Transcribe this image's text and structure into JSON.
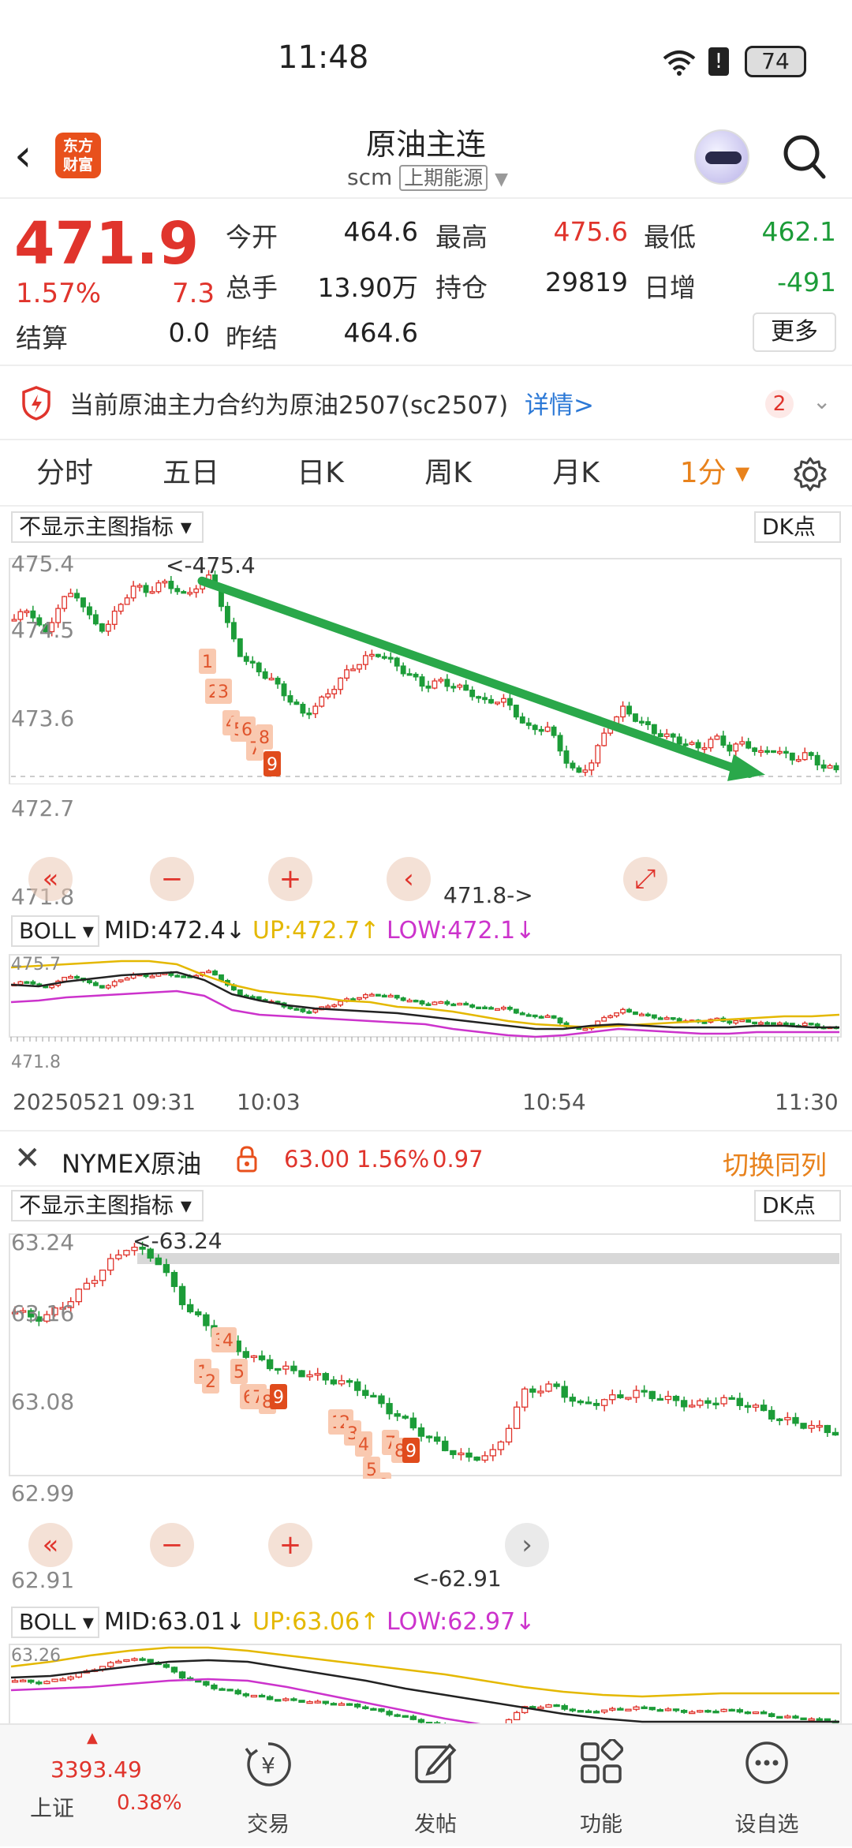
{
  "status": {
    "time": "11:48",
    "battery": "74"
  },
  "header": {
    "title": "原油主连",
    "code": "scm",
    "exchange": "上期能源",
    "logo_text_1": "东方",
    "logo_text_2": "财富"
  },
  "quote": {
    "price": "471.9",
    "change_pct": "1.57%",
    "change": "7.3",
    "fields": [
      {
        "label": "今开",
        "value": "464.6",
        "color": "#222"
      },
      {
        "label": "最高",
        "value": "475.6",
        "color": "#e0342c"
      },
      {
        "label": "最低",
        "value": "462.1",
        "color": "#1c9c38"
      },
      {
        "label": "总手",
        "value": "13.90万",
        "color": "#222"
      },
      {
        "label": "持仓",
        "value": "29819",
        "color": "#222"
      },
      {
        "label": "日增",
        "value": "-491",
        "color": "#1c9c38"
      },
      {
        "label": "结算",
        "value": "0.0",
        "color": "#222"
      },
      {
        "label": "昨结",
        "value": "464.6",
        "color": "#222"
      }
    ],
    "more_label": "更多"
  },
  "notice": {
    "text": "当前原油主力合约为原油2507(sc2507)",
    "link": "详情>",
    "count": "2"
  },
  "tabs": [
    {
      "label": "分时"
    },
    {
      "label": "五日"
    },
    {
      "label": "日K"
    },
    {
      "label": "周K"
    },
    {
      "label": "月K"
    },
    {
      "label": "1分 ▾"
    }
  ],
  "chart1": {
    "indicator_select": "不显示主图指标",
    "dk_label": "DK点",
    "y_ticks": [
      "475.4",
      "474.5",
      "473.6",
      "472.7",
      "471.8"
    ],
    "high_marker": "<-475.4",
    "low_marker": "471.8->",
    "boll_select": "BOLL",
    "mid": "MID:472.4↓",
    "up": "UP:472.7↑",
    "low": "LOW:472.1↓",
    "boll_ticks": [
      "475.7",
      "471.8"
    ],
    "x_ticks": [
      "20250521 09:31",
      "10:03",
      "10:54",
      "11:30"
    ],
    "td_marks": [
      "1",
      "2",
      "3",
      "4",
      "5",
      "6",
      "7",
      "8",
      "9"
    ]
  },
  "nymex": {
    "name": "NYMEX原油",
    "price": "63.00",
    "pct": "1.56%",
    "change": "0.97",
    "switch_label": "切换同列"
  },
  "chart2": {
    "indicator_select": "不显示主图指标",
    "dk_label": "DK点",
    "y_ticks": [
      "63.24",
      "63.16",
      "63.08",
      "62.99",
      "62.91"
    ],
    "high_marker": "<-63.24",
    "low_marker": "<-62.91",
    "boll_select": "BOLL",
    "mid": "MID:63.01↓",
    "up": "UP:63.06↑",
    "low": "LOW:62.97↓",
    "boll_ticks": [
      "63.26"
    ]
  },
  "bottom_nav": {
    "index_value": "3393.49",
    "index_name": "上证",
    "index_pct": "0.38%",
    "items": [
      {
        "label": "交易"
      },
      {
        "label": "发帖"
      },
      {
        "label": "功能"
      },
      {
        "label": "设自选"
      }
    ]
  },
  "chart_data": {
    "type": "candlestick",
    "series": [
      {
        "values": [
          474.6,
          474.8,
          474.3,
          474.9,
          475.1,
          474.6,
          474.4,
          474.9,
          475.2,
          475.1,
          475.3,
          475.0,
          475.2,
          475.4,
          474.5,
          473.9,
          473.7,
          473.5,
          473.2,
          472.9,
          473.1,
          473.4,
          473.7,
          473.9,
          474.0,
          473.8,
          473.6,
          473.4,
          473.5,
          473.4,
          473.3,
          473.1,
          473.2,
          472.9,
          472.6,
          472.7,
          472.2,
          471.8,
          472.1,
          472.7,
          473.0,
          472.8,
          472.6,
          472.5,
          472.4,
          472.3,
          472.5,
          472.3,
          472.4,
          472.2,
          472.3,
          472.1,
          472.2,
          472.0,
          471.9
        ]
      }
    ]
  }
}
